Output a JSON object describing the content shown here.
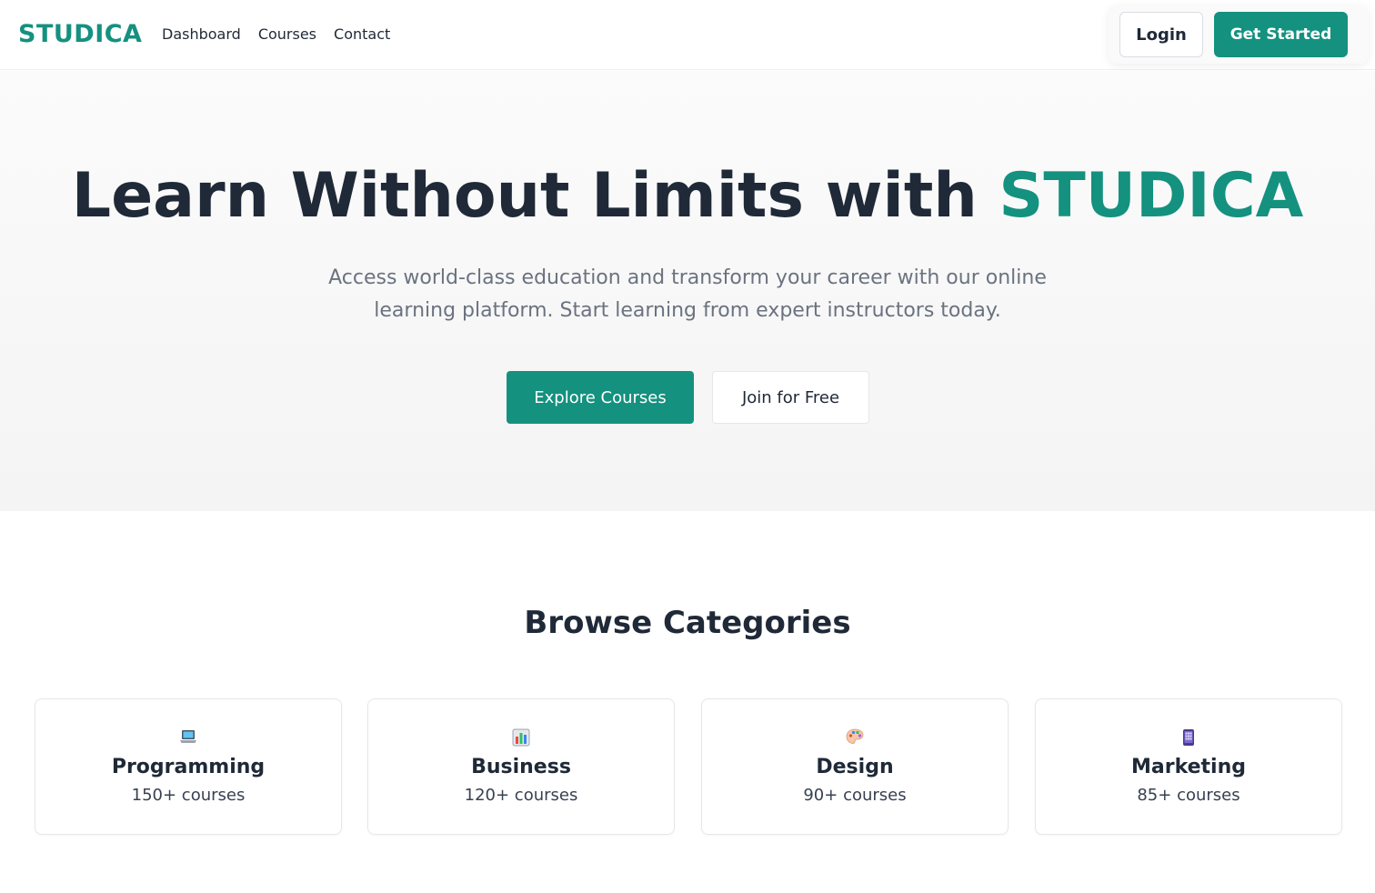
{
  "nav": {
    "logo": "STUDICA",
    "links": [
      "Dashboard",
      "Courses",
      "Contact"
    ],
    "login_label": "Login",
    "get_started_label": "Get Started"
  },
  "hero": {
    "title_main": "Learn Without Limits with ",
    "title_brand": "STUDICA",
    "subtitle": "Access world-class education and transform your career with our online learning platform. Start learning from expert instructors today.",
    "explore_label": "Explore Courses",
    "join_label": "Join for Free"
  },
  "categories": {
    "title": "Browse Categories",
    "items": [
      {
        "name": "Programming",
        "count": "150+ courses",
        "icon": "laptop-icon"
      },
      {
        "name": "Business",
        "count": "120+ courses",
        "icon": "bar-chart-icon"
      },
      {
        "name": "Design",
        "count": "90+ courses",
        "icon": "palette-icon"
      },
      {
        "name": "Marketing",
        "count": "85+ courses",
        "icon": "mobile-phone-icon"
      }
    ]
  },
  "colors": {
    "accent": "#14917f",
    "text_dark": "#1f2937",
    "text_muted": "#6b7280",
    "border": "#e5e7eb"
  }
}
